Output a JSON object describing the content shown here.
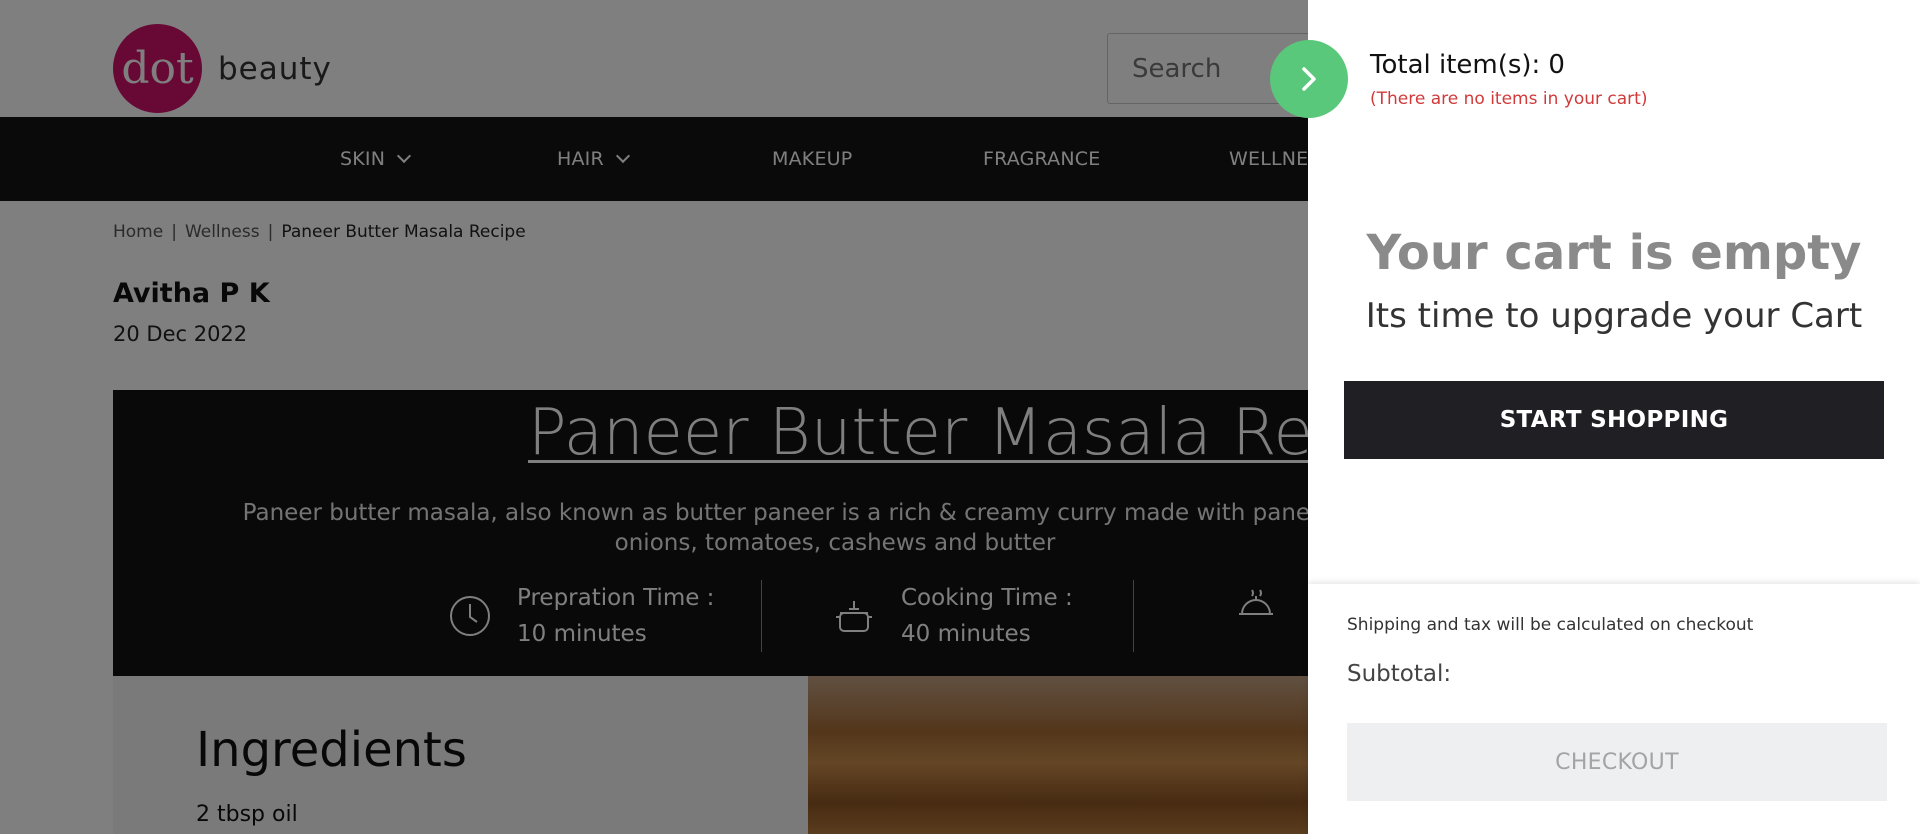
{
  "header": {
    "logo_mark": "dot",
    "logo_text": "beauty",
    "search_placeholder": "Search"
  },
  "nav": {
    "items": [
      {
        "label": "SKIN",
        "dropdown": true
      },
      {
        "label": "HAIR",
        "dropdown": true
      },
      {
        "label": "MAKEUP",
        "dropdown": false
      },
      {
        "label": "FRAGRANCE",
        "dropdown": false
      },
      {
        "label": "WELLNESS",
        "dropdown": false
      }
    ]
  },
  "breadcrumb": {
    "home": "Home",
    "section": "Wellness",
    "current": "Paneer Butter Masala Recipe",
    "separator": "|"
  },
  "article": {
    "author": "Avitha P K",
    "date": "20 Dec 2022",
    "title": "Paneer Butter Masala Recipe",
    "description": "Paneer butter masala, also known as butter paneer is a rich & creamy curry made with paneer, spices, onions, tomatoes, cashews and butter",
    "prep_label": "Prepration Time :",
    "prep_value": "10 minutes",
    "cook_label": "Cooking Time :",
    "cook_value": "40 minutes",
    "ingredients_title": "Ingredients",
    "first_ingredient": "2 tbsp oil"
  },
  "cart": {
    "total_label": "Total item(s):",
    "total_count": "0",
    "empty_note": "(There are no items in your cart)",
    "empty_title": "Your cart is empty",
    "empty_subtitle": "Its time to upgrade your Cart",
    "start_shopping": "START SHOPPING",
    "shipping_note": "Shipping and tax will be calculated on checkout",
    "subtotal_label": "Subtotal:",
    "checkout": "CHECKOUT"
  },
  "colors": {
    "brand": "#d0106b",
    "close_button": "#5ac87a",
    "empty_note": "#d23a3a",
    "dark": "#1f1f24"
  },
  "icons": [
    "chevron-down-icon",
    "clock-icon",
    "cooking-pot-icon",
    "serving-dish-icon",
    "chevron-right-icon"
  ]
}
